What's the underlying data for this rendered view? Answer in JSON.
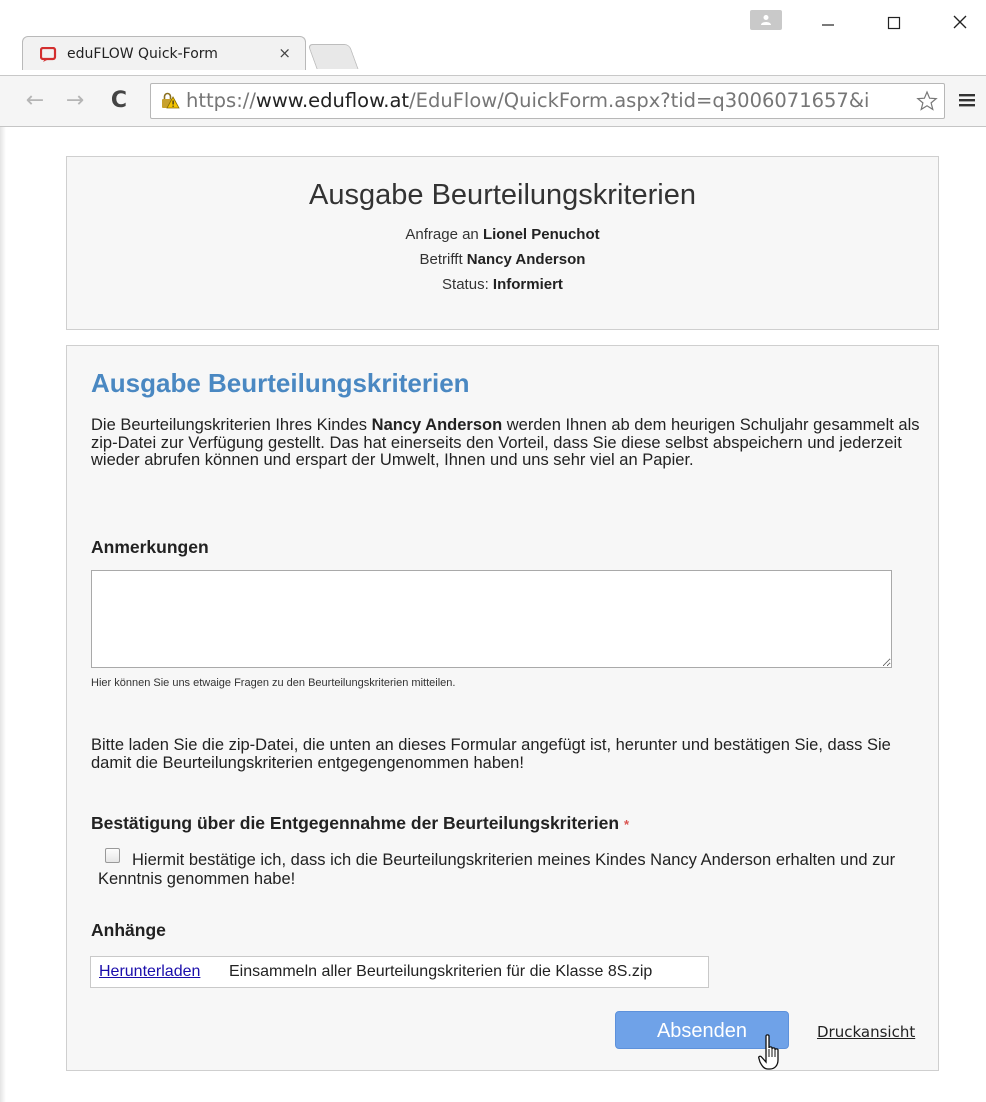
{
  "browser": {
    "tab_title": "eduFLOW Quick-Form",
    "tab_close": "×",
    "url_scheme": "https://",
    "url_host": "www.eduflow.at",
    "url_path": "/EduFlow/QuickForm.aspx?tid=q3006071657&i",
    "icons": [
      "eduflow-favicon",
      "user-icon",
      "minimize-icon",
      "maximize-icon",
      "close-icon",
      "back-arrow-icon",
      "forward-arrow-icon",
      "reload-icon",
      "warning-lock-icon",
      "star-icon",
      "menu-icon"
    ]
  },
  "header": {
    "title": "Ausgabe Beurteilungskriterien",
    "request_label": "Anfrage an",
    "request_value": "Lionel Penuchot",
    "subject_label": "Betrifft",
    "subject_value": "Nancy Anderson",
    "status_label": "Status:",
    "status_value": "Informiert"
  },
  "form": {
    "title": "Ausgabe Beurteilungskriterien",
    "intro_before": "Die Beurteilungskriterien Ihres Kindes",
    "intro_name": "Nancy Anderson",
    "intro_after": "werden Ihnen ab dem heurigen Schuljahr gesammelt als zip-Datei zur Verfügung gestellt. Das hat einerseits den Vorteil, dass Sie diese selbst abspeichern und jederzeit wieder abrufen können und erspart der Umwelt, Ihnen und uns sehr viel an Papier.",
    "remarks_label": "Anmerkungen",
    "remarks_value": "",
    "remarks_hint": "Hier können Sie uns etwaige Fragen zu den Beurteilungskriterien mitteilen.",
    "download_instruction": "Bitte laden Sie die zip-Datei, die unten an dieses Formular angefügt ist, herunter und bestätigen Sie, dass Sie damit die Beurteilungskriterien entgegengenommen haben!",
    "confirmation_label": "Bestätigung über die Entgegennahme der Beurteilungskriterien",
    "required_marker": "*",
    "confirmation_text": "Hiermit bestätige ich, dass ich die Beurteilungskriterien meines Kindes Nancy Anderson erhalten und zur Kenntnis genommen habe!",
    "confirmation_checked": false,
    "attachments_label": "Anhänge",
    "attachment_link": "Herunterladen",
    "attachment_name": "Einsammeln aller Beurteilungskriterien für die Klasse 8S.zip",
    "submit_label": "Absenden",
    "print_label": "Druckansicht"
  },
  "colors": {
    "accent_title": "#4a88c2",
    "submit_button": "#6fa2e8",
    "link": "#1a0dab",
    "required": "#d9534f"
  }
}
